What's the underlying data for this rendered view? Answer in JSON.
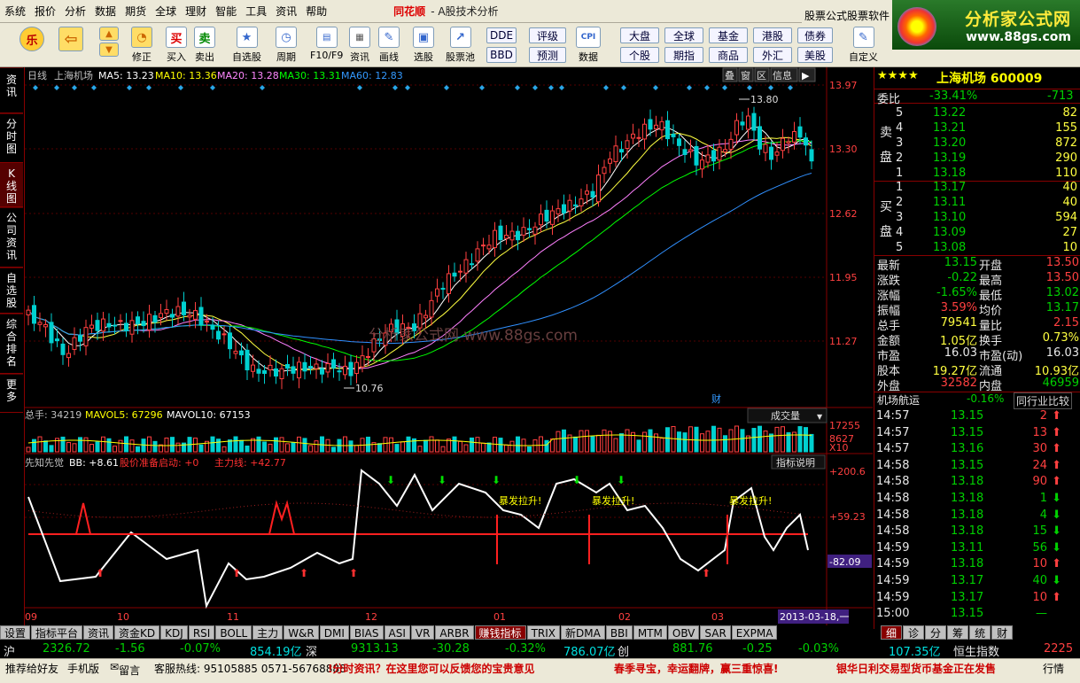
{
  "menu": {
    "items": [
      "系统",
      "报价",
      "分析",
      "数据",
      "期货",
      "全球",
      "理财",
      "智能",
      "工具",
      "资讯",
      "帮助"
    ],
    "brand": "同花顺",
    "subtitle": "- A股技术分析"
  },
  "ad_label": "股票公式股票软件",
  "logo": {
    "name": "分析家公式网",
    "url": "www.88gs.com"
  },
  "toolbar": {
    "buttons": [
      {
        "label": "修正",
        "icon": "lock-icon"
      },
      {
        "label": "买入",
        "icon_text": "买"
      },
      {
        "label": "卖出",
        "icon_text": "卖"
      },
      {
        "label": "自选股",
        "icon": "star-folder-icon"
      },
      {
        "label": "周期",
        "icon": "clock-icon"
      },
      {
        "label": "F10/F9",
        "icon": "f10-icon"
      },
      {
        "label": "资讯",
        "icon": "news-icon"
      },
      {
        "label": "画线",
        "icon": "pencil-icon"
      },
      {
        "label": "选股",
        "icon": "select-icon"
      },
      {
        "label": "股票池",
        "icon": "chart-icon"
      },
      {
        "label": "数据",
        "icon": "cpi-icon",
        "icon_text": "CPI"
      },
      {
        "label": "自定义",
        "icon": "custom-icon"
      }
    ],
    "small_buttons": [
      "DDE",
      "BBD",
      "评级",
      "预测",
      "大盘",
      "个股",
      "全球",
      "期指",
      "基金",
      "商品",
      "港股",
      "外汇",
      "债券",
      "美股"
    ]
  },
  "left_tabs": [
    "资讯",
    "分时图",
    "K线图",
    "公司资讯",
    "自选股",
    "综合排名",
    "更多"
  ],
  "chart": {
    "main_header": {
      "period": "日线",
      "name": "上海机场",
      "ma5": "MA5: 13.23",
      "ma10": "MA10: 13.36",
      "ma20": "MA20: 13.28",
      "ma30": "MA30: 13.31",
      "ma60": "MA60: 12.83"
    },
    "top_buttons": [
      "叠",
      "窗",
      "区",
      "信息"
    ],
    "price_axis": [
      "13.97",
      "13.30",
      "12.62",
      "11.95",
      "11.27"
    ],
    "high_label": "13.80",
    "low_label": "10.76",
    "watermark": "分析家公式网 www.88gs.com",
    "cai_marker": "财",
    "volume_header": {
      "total": "总手: 34219",
      "mavol5": "MAVOL5: 67296",
      "mavol10": "MAVOL10: 67153",
      "selector": "成交量"
    },
    "volume_axis": [
      "17255",
      "8627",
      "X10"
    ],
    "indicator_header": {
      "name": "先知先觉",
      "bb": "BB: +8.61",
      "signal": "股价准备启动: +0",
      "main": "主力线: +42.77",
      "explain": "指标说明"
    },
    "indicator_axis": [
      "+200.6",
      "+59.23",
      "-82.09"
    ],
    "annotations": [
      "暴发拉升!",
      "暴发拉升!",
      "暴发拉升!"
    ],
    "months": [
      "09",
      "10",
      "11",
      "12",
      "01",
      "02",
      "03"
    ],
    "date_label": "2013-03-18,一"
  },
  "quote": {
    "stars": "★★★★",
    "title": "上海机场 600009",
    "weibi": {
      "label": "委比",
      "value": "-33.41%",
      "diff": "-713"
    },
    "sell": [
      {
        "n": "5",
        "price": "13.22",
        "vol": "82"
      },
      {
        "n": "4",
        "price": "13.21",
        "vol": "155"
      },
      {
        "n": "3",
        "price": "13.20",
        "vol": "872"
      },
      {
        "n": "2",
        "price": "13.19",
        "vol": "290"
      },
      {
        "n": "1",
        "price": "13.18",
        "vol": "110"
      }
    ],
    "sell_label": [
      "卖",
      "盘"
    ],
    "buy": [
      {
        "n": "1",
        "price": "13.17",
        "vol": "40"
      },
      {
        "n": "2",
        "price": "13.11",
        "vol": "40"
      },
      {
        "n": "3",
        "price": "13.10",
        "vol": "594"
      },
      {
        "n": "4",
        "price": "13.09",
        "vol": "27"
      },
      {
        "n": "5",
        "price": "13.08",
        "vol": "10"
      }
    ],
    "buy_label": [
      "买",
      "盘"
    ],
    "stats": [
      {
        "l1": "最新",
        "v1": "13.15",
        "l2": "开盘",
        "v2": "13.50"
      },
      {
        "l1": "涨跌",
        "v1": "-0.22",
        "l2": "最高",
        "v2": "13.50"
      },
      {
        "l1": "涨幅",
        "v1": "-1.65%",
        "l2": "最低",
        "v2": "13.02"
      },
      {
        "l1": "振幅",
        "v1": "3.59%",
        "l2": "均价",
        "v2": "13.17"
      },
      {
        "l1": "总手",
        "v1": "79541",
        "l2": "量比",
        "v2": "2.15"
      },
      {
        "l1": "金额",
        "v1": "1.05亿",
        "l2": "换手",
        "v2": "0.73%"
      },
      {
        "l1": "市盈",
        "v1": "16.03",
        "l2": "市盈(动)",
        "v2": "16.03"
      },
      {
        "l1": "股本",
        "v1": "19.27亿",
        "l2": "流通",
        "v2": "10.93亿"
      },
      {
        "l1": "外盘",
        "v1": "32582",
        "l2": "内盘",
        "v2": "46959"
      }
    ],
    "industry": {
      "name": "机场航运",
      "change": "-0.16%",
      "button": "同行业比较"
    },
    "ticks": [
      {
        "t": "14:57",
        "p": "13.15",
        "v": "2",
        "d": "up"
      },
      {
        "t": "14:57",
        "p": "13.15",
        "v": "13",
        "d": "up"
      },
      {
        "t": "14:57",
        "p": "13.16",
        "v": "30",
        "d": "up"
      },
      {
        "t": "14:58",
        "p": "13.15",
        "v": "24",
        "d": "up"
      },
      {
        "t": "14:58",
        "p": "13.18",
        "v": "90",
        "d": "up"
      },
      {
        "t": "14:58",
        "p": "13.18",
        "v": "1",
        "d": "down"
      },
      {
        "t": "14:58",
        "p": "13.18",
        "v": "4",
        "d": "down"
      },
      {
        "t": "14:58",
        "p": "13.18",
        "v": "15",
        "d": "down"
      },
      {
        "t": "14:59",
        "p": "13.11",
        "v": "56",
        "d": "down"
      },
      {
        "t": "14:59",
        "p": "13.18",
        "v": "10",
        "d": "up"
      },
      {
        "t": "14:59",
        "p": "13.17",
        "v": "40",
        "d": "down"
      },
      {
        "t": "14:59",
        "p": "13.17",
        "v": "10",
        "d": "up"
      },
      {
        "t": "15:00",
        "p": "13.15",
        "v": "—",
        "d": "none"
      }
    ]
  },
  "bottom_tabs": [
    "设置",
    "指标平台",
    "资讯",
    "资金KD",
    "KDJ",
    "RSI",
    "BOLL",
    "主力",
    "W&R",
    "DMI",
    "BIAS",
    "ASI",
    "VR",
    "ARBR",
    "赚钱指标",
    "TRIX",
    "新DMA",
    "BBI",
    "MTM",
    "OBV",
    "SAR",
    "EXPMA"
  ],
  "active_bottom_tab": "赚钱指标",
  "right_tabs": [
    "细",
    "诊",
    "分",
    "筹",
    "统",
    "财"
  ],
  "index_bar": {
    "sh_label": "沪",
    "sh": "2326.72",
    "sh_chg": "-1.56",
    "sh_pct": "-0.07%",
    "sh_amt": "854.19亿",
    "sz_label": "深",
    "sz": "9313.13",
    "sz_chg": "-30.28",
    "sz_pct": "-0.32%",
    "sz_amt": "786.07亿",
    "cy_label": "创",
    "cy": "881.76",
    "cy_chg": "-0.25",
    "cy_pct": "-0.03%",
    "hk_amt": "107.35亿",
    "hk_label": "恒生指数",
    "hk": "2225"
  },
  "status": {
    "recommend": "推荐给好友",
    "mobile": "手机版",
    "msg": "留言",
    "hotline": "客服热线: 95105885  0571-56768888",
    "ticker1": "!分时资讯？在这里您可以反馈您的宝贵意见",
    "ticker2": "春季寻宝，幸运翻牌，赢三重惊喜!",
    "ticker3": "银华日利交易型货币基金正在发售",
    "right": "行情"
  },
  "colors": {
    "up": "#ff4040",
    "down": "#00d0d0",
    "ma5": "#ffffff",
    "ma10": "#ffff40",
    "ma20": "#ff80ff",
    "ma30": "#00ff00",
    "ma60": "#3090ff",
    "grid": "#800000",
    "signal": "#ff2020"
  }
}
